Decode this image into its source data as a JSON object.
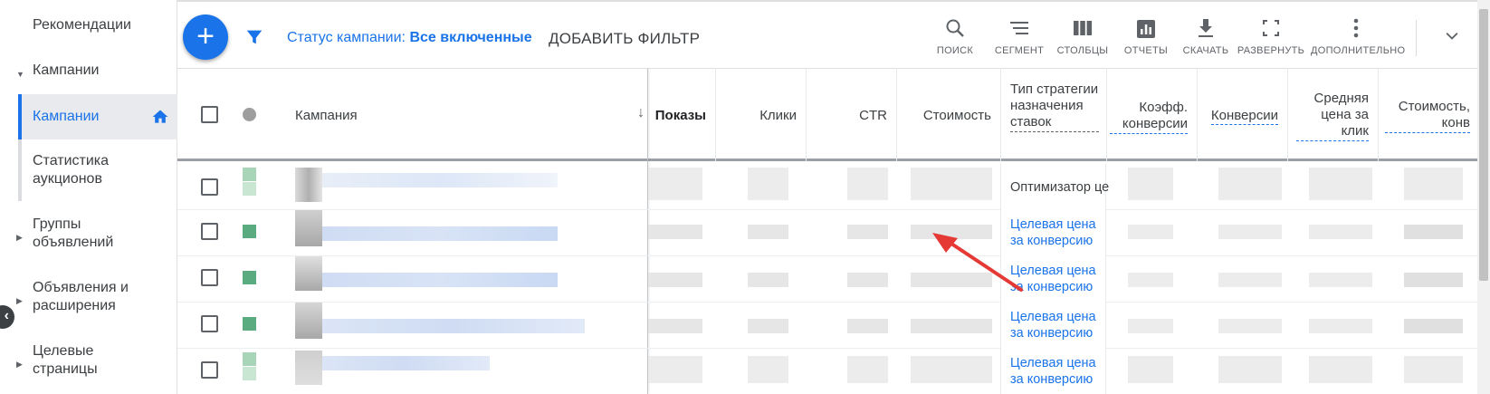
{
  "sidebar": {
    "items": [
      {
        "label": "Рекомендации"
      },
      {
        "label": "Кампании"
      },
      {
        "label": "Кампании"
      },
      {
        "label": "Статистика аукционов"
      },
      {
        "label": "Группы объявлений"
      },
      {
        "label": "Объявления и расширения"
      },
      {
        "label": "Целевые страницы"
      }
    ]
  },
  "toolbar": {
    "fab_label": "+",
    "status_prefix": "Статус кампании:",
    "status_value": "Все включенные",
    "add_filter": "ДОБАВИТЬ ФИЛЬТР",
    "tools": [
      {
        "label": "ПОИСК",
        "icon": "search-icon"
      },
      {
        "label": "СЕГМЕНТ",
        "icon": "segment-icon"
      },
      {
        "label": "СТОЛБЦЫ",
        "icon": "columns-icon"
      },
      {
        "label": "ОТЧЕТЫ",
        "icon": "reports-icon"
      },
      {
        "label": "СКАЧАТЬ",
        "icon": "download-icon"
      },
      {
        "label": "РАЗВЕРНУТЬ",
        "icon": "fullscreen-icon"
      },
      {
        "label": "ДОПОЛНИТЕЛЬНО",
        "icon": "more-icon"
      }
    ]
  },
  "table": {
    "headers": {
      "campaign": "Кампания",
      "impressions": "Показы",
      "clicks": "Клики",
      "ctr": "CTR",
      "cost": "Стоимость",
      "bid_strategy_type": "Тип стратегии назначения ставок",
      "conv_rate": "Коэфф. конверсии",
      "conversions": "Конверсии",
      "avg_cpc": "Средняя цена за клик",
      "cost_per_conv": "Стоимость, конв"
    },
    "rows": [
      {
        "bid_strategy": "Оптимизатор це"
      },
      {
        "bid_strategy": "Целевая цена за конверсию"
      },
      {
        "bid_strategy": "Целевая цена за конверсию"
      },
      {
        "bid_strategy": "Целевая цена за конверсию"
      },
      {
        "bid_strategy": "Целевая цена за конверсию"
      }
    ]
  },
  "colors": {
    "accent": "#1a73e8",
    "status_green": "#5bab80",
    "annotation_arrow": "#e53935"
  }
}
